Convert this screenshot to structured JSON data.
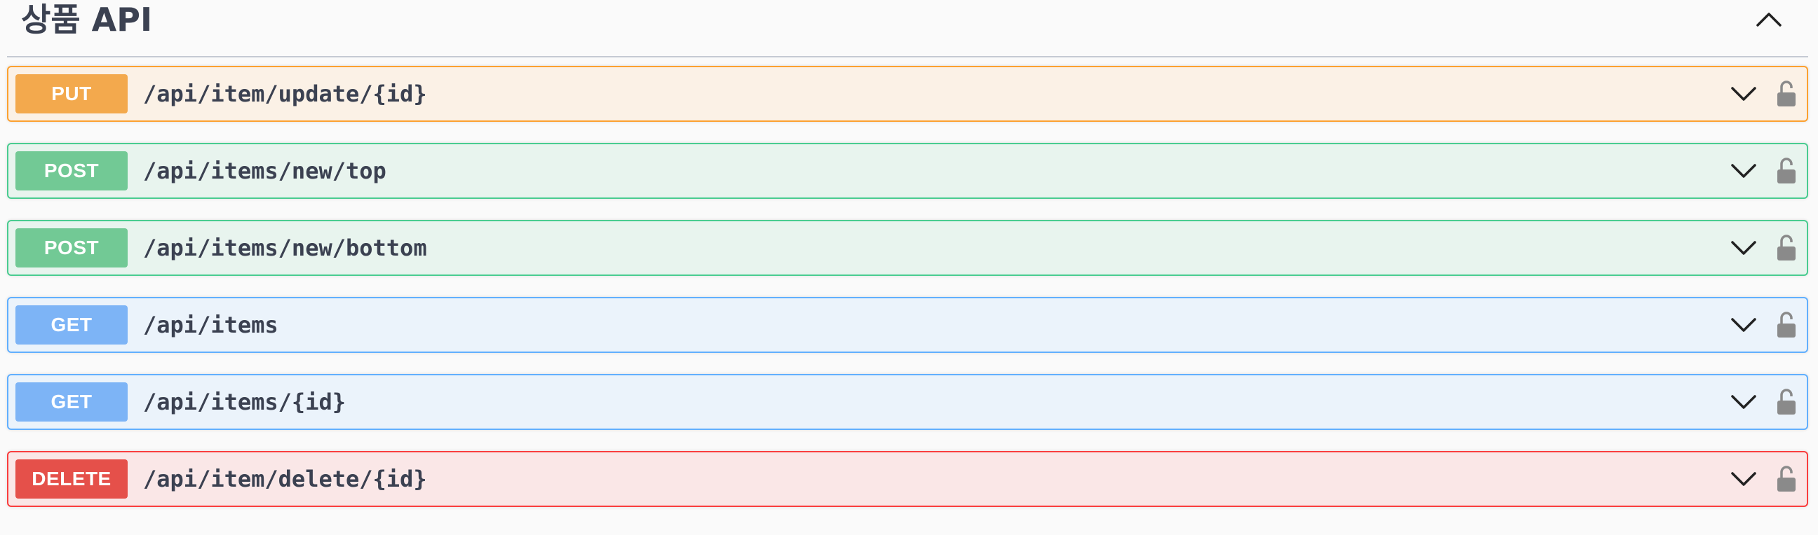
{
  "section": {
    "title": "상품 API",
    "collapse_icon": "chevron-up-icon"
  },
  "operations": [
    {
      "method": "PUT",
      "path": "/api/item/update/{id}",
      "style": "put",
      "color": "#fca130"
    },
    {
      "method": "POST",
      "path": "/api/items/new/top",
      "style": "post",
      "color": "#49cc90"
    },
    {
      "method": "POST",
      "path": "/api/items/new/bottom",
      "style": "post",
      "color": "#49cc90"
    },
    {
      "method": "GET",
      "path": "/api/items",
      "style": "get",
      "color": "#61affe"
    },
    {
      "method": "GET",
      "path": "/api/items/{id}",
      "style": "get",
      "color": "#61affe"
    },
    {
      "method": "DELETE",
      "path": "/api/item/delete/{id}",
      "style": "delete",
      "color": "#f93e3e"
    }
  ],
  "icons": {
    "expand": "chevron-down-icon",
    "auth": "lock-icon"
  }
}
